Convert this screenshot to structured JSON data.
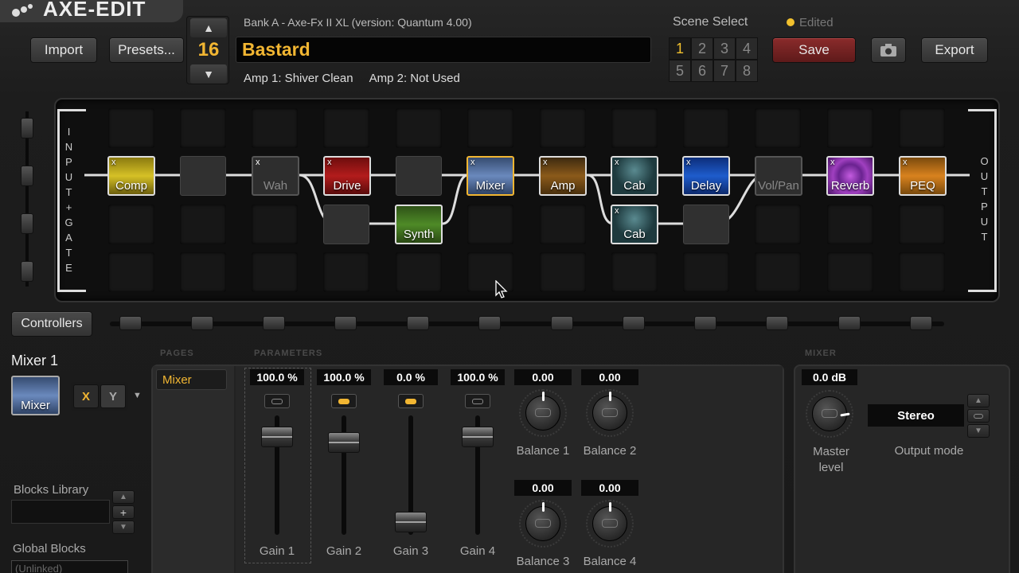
{
  "app": {
    "logo": "AXE-EDIT"
  },
  "toolbar": {
    "import_label": "Import",
    "presets_label": "Presets...",
    "save_label": "Save",
    "export_label": "Export"
  },
  "preset": {
    "number": "16",
    "name": "Bastard",
    "bank_line": "Bank A - Axe-Fx II XL (version: Quantum 4.00)",
    "amp1": "Amp 1: Shiver Clean",
    "amp2": "Amp 2: Not Used"
  },
  "scenes": {
    "label": "Scene Select",
    "items": [
      "1",
      "2",
      "3",
      "4",
      "5",
      "6",
      "7",
      "8"
    ],
    "active": "1",
    "edited_label": "Edited"
  },
  "grid": {
    "input_label": [
      "I",
      "N",
      "P",
      "U",
      "T",
      "+",
      "G",
      "A",
      "T",
      "E"
    ],
    "output_label": [
      "O",
      "U",
      "T",
      "P",
      "U",
      "T"
    ],
    "blocks": [
      {
        "label": "Comp",
        "color": "#d6c126"
      },
      {
        "label": "Wah",
        "color": "#2e2e2e"
      },
      {
        "label": "Drive",
        "color": "#a11616"
      },
      {
        "label": "Synth",
        "color": "#3d6b1f"
      },
      {
        "label": "Mixer",
        "color": "#4f6c9b"
      },
      {
        "label": "Amp",
        "color": "#8b5a1a"
      },
      {
        "label": "Cab",
        "color": "#27484d"
      },
      {
        "label": "Cab",
        "color": "#27484d"
      },
      {
        "label": "Delay",
        "color": "#1848a5"
      },
      {
        "label": "Vol/Pan",
        "color": "#2e2e2e"
      },
      {
        "label": "Reverb",
        "color": "#7a2f9b"
      },
      {
        "label": "PEQ",
        "color": "#c2761a"
      }
    ]
  },
  "controllers": {
    "label": "Controllers"
  },
  "block_editor": {
    "title": "Mixer 1",
    "block_label": "Mixer",
    "x_label": "X",
    "y_label": "Y",
    "pages_header": "PAGES",
    "params_header": "PARAMETERS",
    "page_item": "Mixer",
    "mixer_header": "MIXER"
  },
  "params": {
    "gains": [
      {
        "value": "100.0 %",
        "label": "Gain 1",
        "level": 0.85
      },
      {
        "value": "100.0 %",
        "label": "Gain 2",
        "level": 0.8
      },
      {
        "value": "0.0 %",
        "label": "Gain 3",
        "level": 0.05
      },
      {
        "value": "100.0 %",
        "label": "Gain 4",
        "level": 0.85
      }
    ],
    "balances": [
      {
        "value": "0.00",
        "label": "Balance 1"
      },
      {
        "value": "0.00",
        "label": "Balance 2"
      },
      {
        "value": "0.00",
        "label": "Balance 3"
      },
      {
        "value": "0.00",
        "label": "Balance 4"
      }
    ]
  },
  "mixer": {
    "master_value": "0.0 dB",
    "master_label": "Master level",
    "output_mode_value": "Stereo",
    "output_mode_label": "Output mode"
  },
  "library": {
    "blocks_library_label": "Blocks Library",
    "global_blocks_label": "Global Blocks",
    "global_blocks_value": "(Unlinked)"
  }
}
